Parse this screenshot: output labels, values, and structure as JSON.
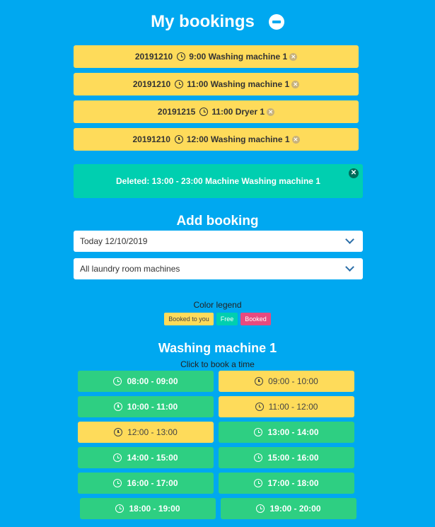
{
  "header": {
    "title": "My bookings"
  },
  "bookings": [
    {
      "date": "20191210",
      "time": "9:00",
      "machine": "Washing machine 1"
    },
    {
      "date": "20191210",
      "time": "11:00",
      "machine": "Washing machine 1"
    },
    {
      "date": "20191215",
      "time": "11:00",
      "machine": "Dryer 1"
    },
    {
      "date": "20191210",
      "time": "12:00",
      "machine": "Washing machine 1"
    }
  ],
  "notice": {
    "text": "Deleted: 13:00 - 23:00 Machine Washing machine 1",
    "close_icon": "close-icon"
  },
  "add_booking": {
    "title": "Add booking",
    "date_select": "Today 12/10/2019",
    "machine_select": "All laundry room machines"
  },
  "legend": {
    "title": "Color legend",
    "booked_to_you": "Booked to you",
    "free": "Free",
    "booked": "Booked"
  },
  "machine": {
    "name": "Washing machine 1",
    "hint": "Click to book a time",
    "slots": [
      {
        "label": "08:00 - 09:00",
        "status": "free"
      },
      {
        "label": "09:00 - 10:00",
        "status": "booked_to_you"
      },
      {
        "label": "10:00 - 11:00",
        "status": "free"
      },
      {
        "label": "11:00 - 12:00",
        "status": "booked_to_you"
      },
      {
        "label": "12:00 - 13:00",
        "status": "booked_to_you"
      },
      {
        "label": "13:00 - 14:00",
        "status": "free"
      },
      {
        "label": "14:00 - 15:00",
        "status": "free"
      },
      {
        "label": "15:00 - 16:00",
        "status": "free"
      },
      {
        "label": "16:00 - 17:00",
        "status": "free"
      },
      {
        "label": "17:00 - 18:00",
        "status": "free"
      },
      {
        "label": "18:00 - 19:00",
        "status": "free"
      },
      {
        "label": "19:00 - 20:00",
        "status": "free"
      }
    ]
  },
  "colors": {
    "background": "#00a8f0",
    "booked_to_you": "#fedb5a",
    "free": "#2ecf82",
    "notice": "#00cfb0",
    "booked": "#e84a7f"
  }
}
